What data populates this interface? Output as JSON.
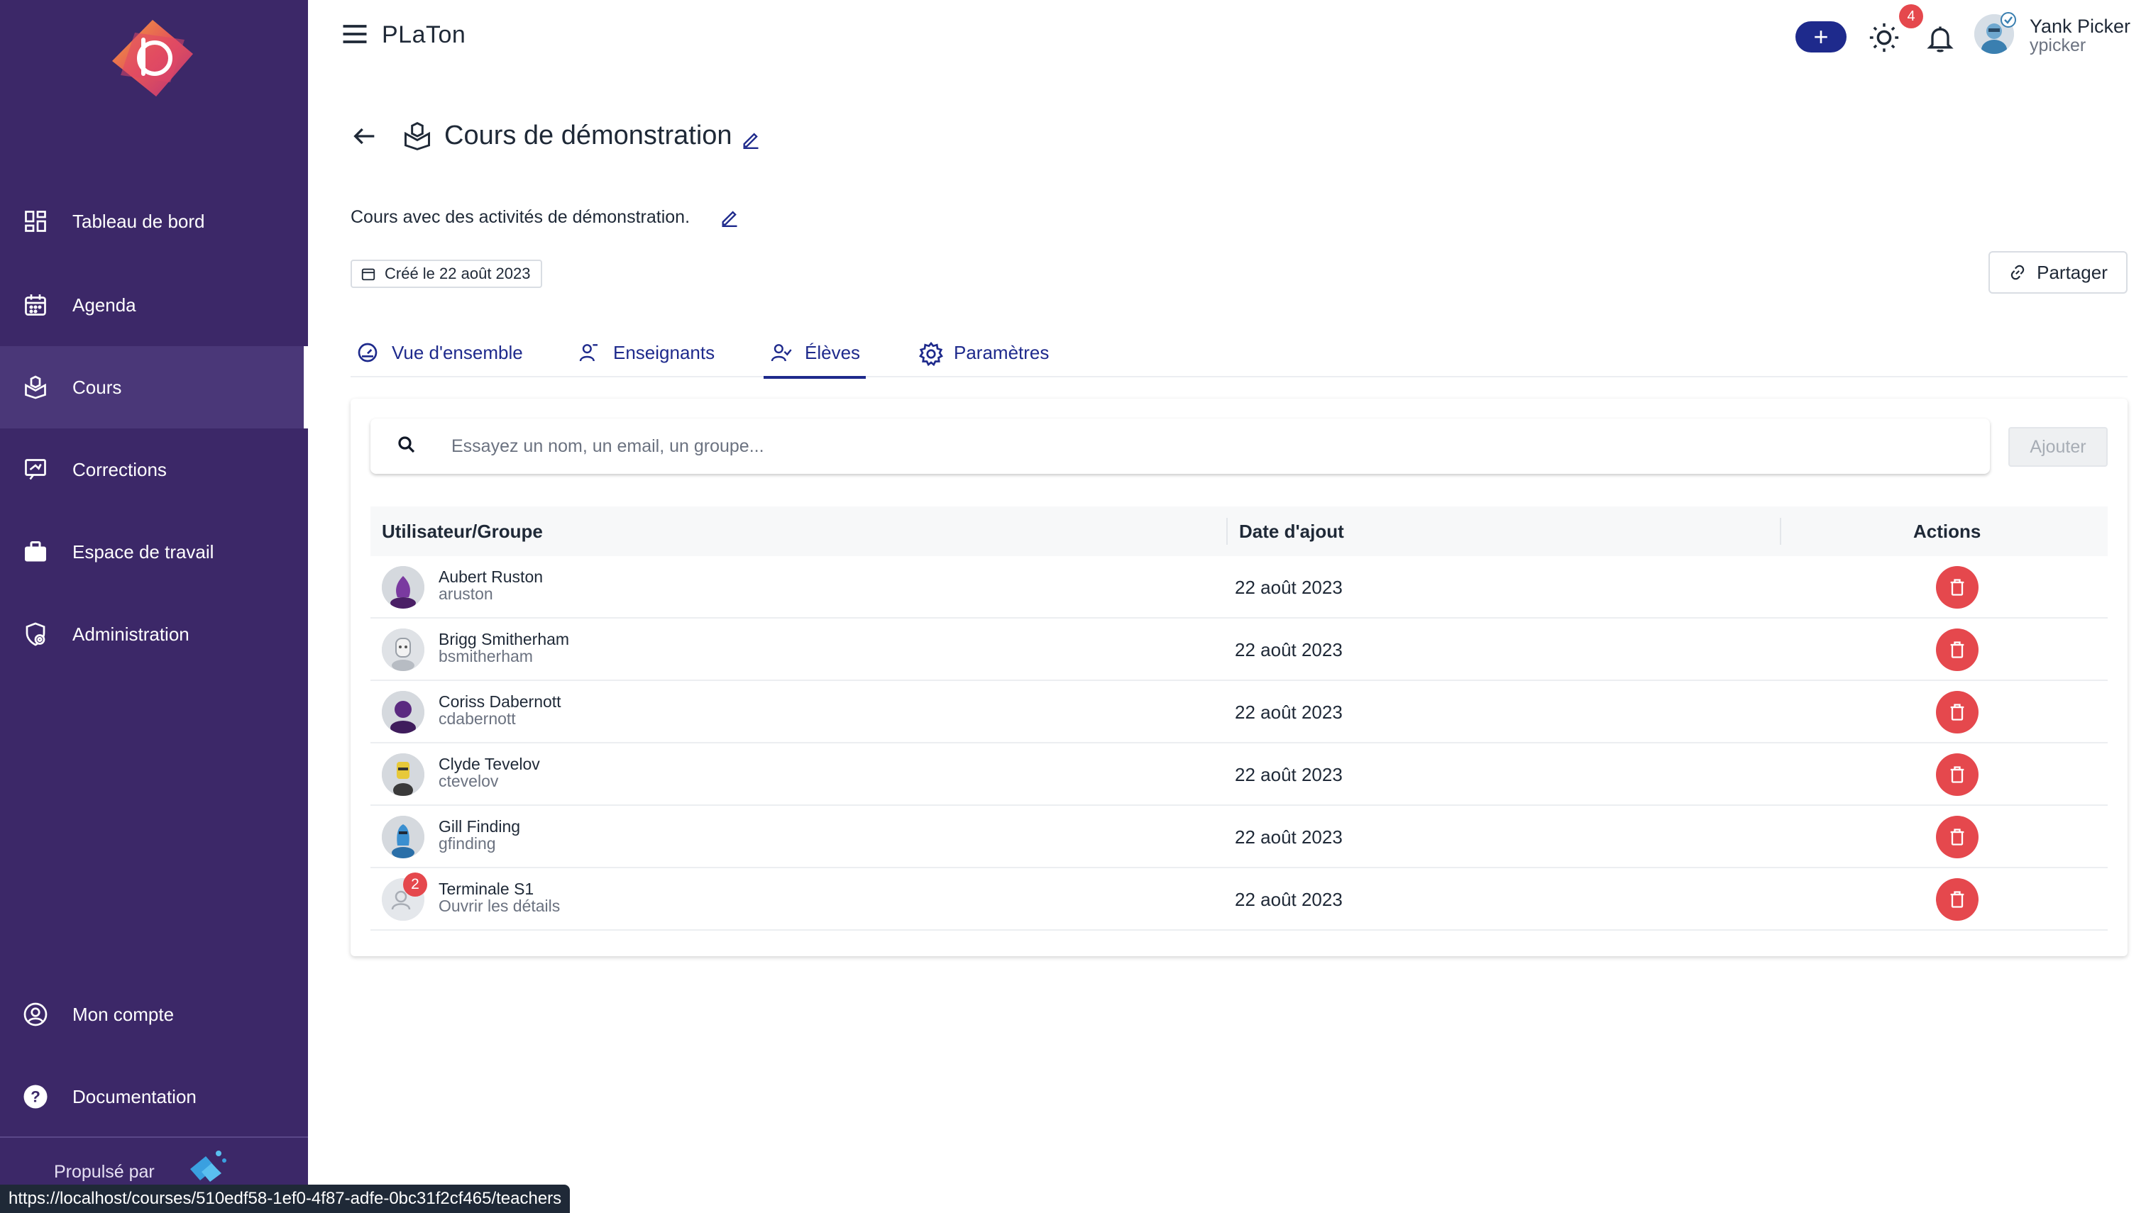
{
  "app": {
    "title": "PLaTon"
  },
  "sidebar": {
    "items": [
      {
        "label": "Tableau de bord",
        "icon": "dashboard-icon"
      },
      {
        "label": "Agenda",
        "icon": "calendar-icon"
      },
      {
        "label": "Cours",
        "icon": "course-icon",
        "active": true
      },
      {
        "label": "Corrections",
        "icon": "corrections-icon"
      },
      {
        "label": "Espace de travail",
        "icon": "briefcase-icon"
      },
      {
        "label": "Administration",
        "icon": "admin-shield-icon"
      }
    ],
    "bottom_items": [
      {
        "label": "Mon compte",
        "icon": "account-icon"
      },
      {
        "label": "Documentation",
        "icon": "help-icon"
      }
    ],
    "powered_by": "Propulsé par"
  },
  "topbar": {
    "add_label": "+",
    "notification_count": "4",
    "user": {
      "name": "Yank Picker",
      "handle": "ypicker"
    }
  },
  "page": {
    "title": "Cours de démonstration",
    "description": "Cours avec des activités de démonstration.",
    "created": "Créé le 22 août 2023",
    "share_label": "Partager"
  },
  "tabs": [
    {
      "label": "Vue d'ensemble",
      "icon": "gauge-icon"
    },
    {
      "label": "Enseignants",
      "icon": "teacher-icon"
    },
    {
      "label": "Élèves",
      "icon": "students-icon",
      "active": true
    },
    {
      "label": "Paramètres",
      "icon": "settings-gear-icon"
    }
  ],
  "search": {
    "placeholder": "Essayez un nom, un email, un groupe...",
    "value": ""
  },
  "add_button": "Ajouter",
  "table": {
    "headers": {
      "user": "Utilisateur/Groupe",
      "date": "Date d'ajout",
      "actions": "Actions"
    },
    "rows": [
      {
        "name": "Aubert Ruston",
        "sub": "aruston",
        "date": "22 août 2023",
        "avatar_color": "#7a3aa0"
      },
      {
        "name": "Brigg Smitherham",
        "sub": "bsmitherham",
        "date": "22 août 2023",
        "avatar_color": "#c7cbd1"
      },
      {
        "name": "Coriss Dabernott",
        "sub": "cdabernott",
        "date": "22 août 2023",
        "avatar_color": "#5b2a80"
      },
      {
        "name": "Clyde Tevelov",
        "sub": "ctevelov",
        "date": "22 août 2023",
        "avatar_color": "#e7c93a"
      },
      {
        "name": "Gill Finding",
        "sub": "gfinding",
        "date": "22 août 2023",
        "avatar_color": "#3a8fd0"
      },
      {
        "name": "Terminale S1",
        "sub": "Ouvrir les détails",
        "date": "22 août 2023",
        "group": true,
        "member_count": "2"
      }
    ]
  },
  "status_url": "https://localhost/courses/510edf58-1ef0-4f87-adfe-0bc31f2cf465/teachers",
  "colors": {
    "sidebar": "#3c2868",
    "primary": "#1e2a8c",
    "danger": "#e5484d"
  }
}
